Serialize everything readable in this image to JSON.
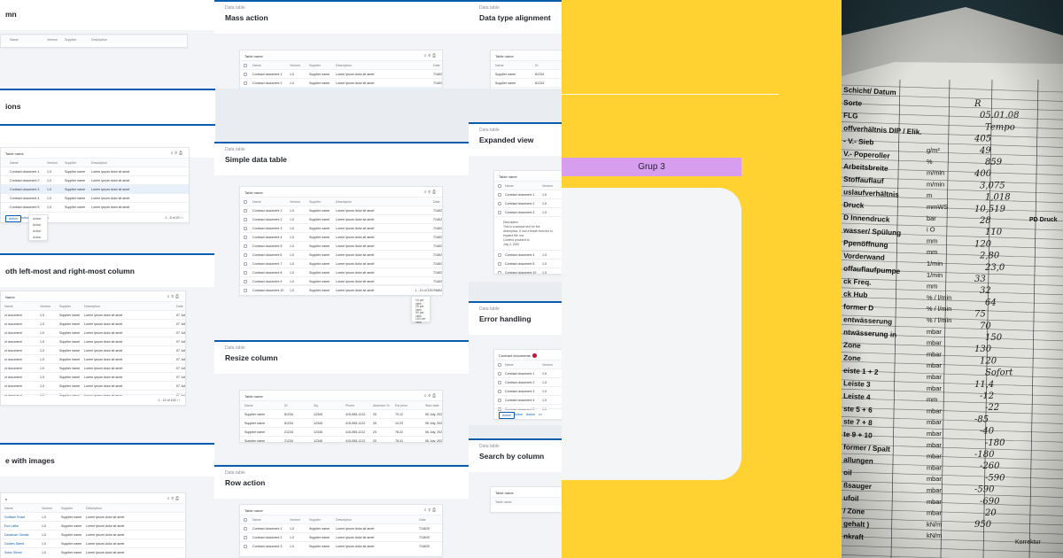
{
  "left": {
    "col1": [
      {
        "title": "mn",
        "table": {
          "name": "",
          "headers": [
            "Name",
            "Version",
            "Supplier",
            "Description",
            "Draft"
          ],
          "rows": []
        }
      },
      {
        "title": "ions"
      },
      {
        "title": "",
        "table": {
          "name": "Table name",
          "headers": [
            "Name",
            "Version",
            "Supplier",
            "Description",
            "Date"
          ],
          "rows": [
            [
              "Contract document 1",
              "1.0",
              "Supplier name",
              "Lorem ipsum dolor sit amet",
              "7/18/20"
            ],
            [
              "Contract document 2",
              "1.0",
              "Supplier name",
              "Lorem ipsum dolor sit amet",
              "7/18/20"
            ],
            [
              "Contract document 3",
              "1.0",
              "Supplier name",
              "Lorem ipsum dolor sit amet",
              "7/18/20"
            ],
            [
              "Contract document 4",
              "1.0",
              "Supplier name",
              "Lorem ipsum dolor sit amet",
              "7/18/20"
            ],
            [
              "Contract document 5",
              "1.0",
              "Supplier name",
              "Lorem ipsum dolor sit amet",
              "7/18/20"
            ]
          ],
          "footer": {
            "actions": [
              "Action",
              "Action",
              "Action",
              "•••"
            ],
            "pager": "1 - 5 of 20"
          },
          "menu": [
            "Action",
            "Action",
            "Action",
            "Action"
          ]
        }
      },
      {
        "title": "oth left-most and right-most column",
        "table": {
          "name": "Name",
          "headers": [
            "Name",
            "Version",
            "Supplier",
            "Description",
            "Date"
          ],
          "rows": [
            [
              "ct document",
              "1.0",
              "Supplier name",
              "Lorem ipsum dolor sit amet",
              "07 July, 2020"
            ],
            [
              "ct document",
              "1.0",
              "Supplier name",
              "Lorem ipsum dolor sit amet",
              "07 July, 2020"
            ],
            [
              "ct document",
              "1.0",
              "Supplier name",
              "Lorem ipsum dolor sit amet",
              "07 July, 2020"
            ],
            [
              "ct document",
              "1.0",
              "Supplier name",
              "Lorem ipsum dolor sit amet",
              "07 July, 2020"
            ],
            [
              "ct document",
              "1.0",
              "Supplier name",
              "Lorem ipsum dolor sit amet",
              "07 July, 2020"
            ],
            [
              "ct document",
              "1.0",
              "Supplier name",
              "Lorem ipsum dolor sit amet",
              "07 July, 2020"
            ],
            [
              "ct document",
              "1.0",
              "Supplier name",
              "Lorem ipsum dolor sit amet",
              "07 July, 2020"
            ],
            [
              "ct document",
              "1.0",
              "Supplier name",
              "Lorem ipsum dolor sit amet",
              "07 July, 2020"
            ],
            [
              "ct document",
              "1.0",
              "Supplier name",
              "Lorem ipsum dolor sit amet",
              "07 July, 2020"
            ],
            [
              "ct document",
              "1.0",
              "Supplier name",
              "Lorem ipsum dolor sit amet",
              "07 July, 2020"
            ]
          ],
          "footer": {
            "pager": "1 - 10 of 100"
          }
        }
      },
      {
        "title": "e with images",
        "table": {
          "name": "e",
          "headers": [
            "Name",
            "Version",
            "Supplier",
            "Description",
            "Date"
          ],
          "rows": [
            [
              "Golfside Road",
              "1.0",
              "Supplier name",
              "Lorem ipsum dolor sit amet",
              "7/18/20"
            ],
            [
              "Fun Lathe",
              "1.0",
              "Supplier name",
              "Lorem ipsum dolor sit amet",
              "7/18/20"
            ],
            [
              "Dankman Shoals",
              "1.0",
              "Supplier name",
              "Lorem ipsum dolor sit amet",
              "7/18/20"
            ],
            [
              "Golden Street",
              "1.0",
              "Supplier name",
              "Lorem ipsum dolor sit amet",
              "7/18/20"
            ],
            [
              "Sonic Street",
              "1.0",
              "Supplier name",
              "Lorem ipsum dolor sit amet",
              "7/18/20"
            ]
          ]
        }
      }
    ],
    "col2": [
      {
        "cat": "Data table",
        "title": "Mass action",
        "table": {
          "name": "Table name",
          "headers": [
            "Name",
            "Version",
            "Supplier",
            "Description",
            "Date"
          ],
          "rows": [
            [
              "Contract document 1",
              "1.0",
              "Supplier name",
              "Lorem ipsum dolor sit amet",
              "7/18/20"
            ],
            [
              "Contract document 2",
              "1.0",
              "Supplier name",
              "Lorem ipsum dolor sit amet",
              "7/18/20"
            ],
            [
              "Contract document 3",
              "1.0",
              "Supplier name",
              "Lorem ipsum dolor sit amet",
              "7/18/20"
            ],
            [
              "Contract document 4",
              "1.0",
              "Supplier name",
              "Lorem ipsum dolor sit amet",
              "7/18/20"
            ],
            [
              "Contract document 5",
              "1.0",
              "Supplier name",
              "Lorem ipsum dolor sit amet",
              "7/18/20"
            ],
            [
              "Contract document 6",
              "1.0",
              "Supplier name",
              "Lorem ipsum dolor sit amet",
              "7/18/20"
            ]
          ],
          "footer": {
            "actions": [
              "Action",
              "Action",
              "Action",
              "•••"
            ],
            "pager": "1 - 6 of 20"
          }
        }
      },
      {
        "cat": "Data table",
        "title": "Simple data table",
        "table": {
          "name": "Table name",
          "headers": [
            "Name",
            "Version",
            "Supplier",
            "Description",
            "Date"
          ],
          "rows": [
            [
              "Contract document 1",
              "1.0",
              "Supplier name",
              "Lorem ipsum dolor sit amet",
              "7/18/20"
            ],
            [
              "Contract document 2",
              "1.0",
              "Supplier name",
              "Lorem ipsum dolor sit amet",
              "7/18/20"
            ],
            [
              "Contract document 3",
              "1.0",
              "Supplier name",
              "Lorem ipsum dolor sit amet",
              "7/18/20"
            ],
            [
              "Contract document 4",
              "1.0",
              "Supplier name",
              "Lorem ipsum dolor sit amet",
              "7/18/20"
            ],
            [
              "Contract document 5",
              "1.0",
              "Supplier name",
              "Lorem ipsum dolor sit amet",
              "7/18/20"
            ],
            [
              "Contract document 6",
              "1.0",
              "Supplier name",
              "Lorem ipsum dolor sit amet",
              "7/18/20"
            ],
            [
              "Contract document 7",
              "1.0",
              "Supplier name",
              "Lorem ipsum dolor sit amet",
              "7/18/20"
            ],
            [
              "Contract document 8",
              "1.0",
              "Supplier name",
              "Lorem ipsum dolor sit amet",
              "7/18/20"
            ],
            [
              "Contract document 9",
              "1.0",
              "Supplier name",
              "Lorem ipsum dolor sit amet",
              "7/18/20"
            ],
            [
              "Contract document 10",
              "1.0",
              "Supplier name",
              "Lorem ipsum dolor sit amet",
              "7/18/20"
            ]
          ],
          "footer": {
            "pager": "1 - 10 of 100"
          },
          "menu": [
            "10 per view",
            "25 per view",
            "50 per view",
            "100 per view"
          ]
        }
      },
      {
        "cat": "Data table",
        "title": "Resize column",
        "table": {
          "name": "Table name",
          "headers": [
            "Name",
            "ID",
            "Zip",
            "Phone",
            "Abandon %",
            "Est price",
            "Start date"
          ],
          "rows": [
            [
              "Supplier name",
              "81234",
              "12345",
              "415-555-1212",
              "20",
              "79.12",
              "06 July, 2020"
            ],
            [
              "Supplier name",
              "81234",
              "12345",
              "415-555-1212",
              "20",
              "12.23",
              "06 July, 2020"
            ],
            [
              "Supplier name",
              "21234",
              "12345",
              "415-555-1212",
              "20",
              "78.22",
              "06 July, 2020"
            ],
            [
              "Supplier name",
              "21234",
              "12345",
              "415-555-1212",
              "20",
              "78.41",
              "06 July, 2020"
            ],
            [
              "Supplier name",
              "21234",
              "12345",
              "415-555-1212",
              "20",
              "76.11",
              "06 July, 2020"
            ]
          ]
        }
      },
      {
        "cat": "Data table",
        "title": "Row action",
        "table": {
          "name": "Table name",
          "headers": [
            "Name",
            "Version",
            "Supplier",
            "Description",
            "Date"
          ],
          "rows": [
            [
              "Contract document 1",
              "1.0",
              "Supplier name",
              "Lorem ipsum dolor sit amet",
              "7/18/20"
            ],
            [
              "Contract document 2",
              "1.0",
              "Supplier name",
              "Lorem ipsum dolor sit amet",
              "7/18/20"
            ],
            [
              "Contract document 3",
              "1.0",
              "Supplier name",
              "Lorem ipsum dolor sit amet",
              "7/18/20"
            ]
          ]
        }
      }
    ],
    "col3": [
      {
        "cat": "Data table",
        "title": "Data type alignment",
        "table": {
          "name": "Table name",
          "headers": [
            "Name",
            "ID"
          ],
          "rows": [
            [
              "Supplier name",
              "81234"
            ],
            [
              "Supplier name",
              "81234"
            ],
            [
              "Supplier name",
              "21234"
            ],
            [
              "Supplier name",
              "21234"
            ],
            [
              "Supplier name",
              "21234"
            ]
          ]
        }
      },
      {
        "cat": "Data table",
        "title": "Expanded view",
        "table": {
          "name": "Table name",
          "headers": [
            "Name",
            "Version"
          ],
          "rows": [
            [
              "Contract document 1",
              "1.0"
            ],
            [
              "Contract document 2",
              "1.0"
            ],
            [
              "Contract document 3",
              "1.0"
            ]
          ],
          "detail": {
            "label": "Description",
            "text": "This is a sample text for the description. If use a break from the to expand the row",
            "date_label": "Content provided to",
            "date": "July 2, 2020"
          },
          "rows2": [
            [
              "Contract document 4",
              "1.0"
            ],
            [
              "Contract document 5",
              "1.0"
            ],
            [
              "Contract document 10",
              "1.0"
            ]
          ]
        }
      },
      {
        "cat": "Data table",
        "title": "Error handling",
        "table": {
          "name": "Contract documents",
          "headers": [
            "Name",
            "Version"
          ],
          "rows": [
            [
              "Contract document 1",
              "1.0"
            ],
            [
              "Contract document 2",
              "1.0"
            ],
            [
              "Contract document 3",
              "1.0"
            ],
            [
              "Contract document 4",
              "1.0"
            ],
            [
              "Contract document 5",
              "1.0"
            ]
          ],
          "footer": {
            "actions": [
              "Action",
              "Action",
              "Action",
              "•••"
            ]
          }
        }
      },
      {
        "cat": "Data table",
        "title": "Search by column",
        "table": {
          "name": "Table name",
          "headers": [
            "Table name"
          ],
          "rows": []
        }
      }
    ]
  },
  "center": {
    "group_label": "Grup 3"
  },
  "photo": {
    "lines": [
      "Schicht/ Datum",
      "Sorte",
      "FLG",
      "offverhältnis DIP / Elik.",
      "- V.- Sieb",
      "V.- Poperoller",
      "Arbeitsbreite",
      "Stoffauflauf",
      "uslaufverhältnis",
      "Druck",
      "D Innendruck",
      "wasser/ Spülung",
      "Ppenöffnung",
      "Vorderwand",
      "offauflaufpumpe",
      "ck Freq.",
      "ck Hub",
      "former D",
      "entwässerung",
      "ntwässerung in",
      "Zone",
      "Zone",
      "eiste 1 + 2",
      "Leiste 3",
      "Leiste 4",
      "ste 5 + 6",
      "ste 7 + 8",
      "te 9 + 10",
      "former / Spalt",
      "allungen",
      "oil",
      "ßsauger",
      "ufoil",
      "/ Zone",
      "gehalt )",
      "nkraft"
    ],
    "units": [
      "g/m²",
      "%",
      "m/min",
      "m/min",
      "m",
      "mmWS",
      "bar",
      "i O",
      "mm",
      "mm",
      "1/min",
      "1/min",
      "mm",
      "% / l/min",
      "% / l/min",
      "% / l/min",
      "mbar",
      "mbar",
      "mbar",
      "mbar",
      "mbar",
      "mbar",
      "mm",
      "mbar",
      "mbar",
      "mbar",
      "mbar",
      "mbar",
      "mbar",
      "mbar",
      "mbar",
      "mbar",
      "mbar",
      "kN/m",
      "kN/m"
    ],
    "handwritten": [
      "R",
      "05.01.08",
      "Tempo",
      "405",
      "49",
      "859",
      "400",
      "3,075",
      "1,018",
      "10,519",
      "28",
      "110",
      "120",
      "2,80",
      "23,0",
      "33",
      "32",
      "64",
      "75",
      "70",
      "150",
      "130",
      "120",
      "Sofort",
      "11,4",
      "-12",
      "-22",
      "-85",
      "-40",
      "-180",
      "-180",
      "-260",
      "-590",
      "-590",
      "-690",
      "20",
      "950"
    ],
    "extra": [
      "PD Druck",
      "Korrektur"
    ]
  }
}
